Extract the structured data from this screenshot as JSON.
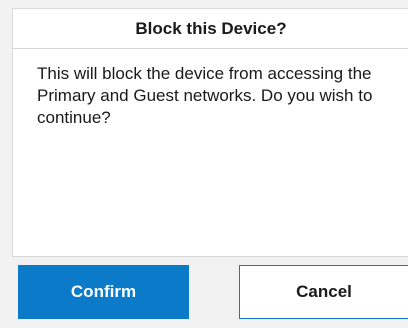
{
  "dialog": {
    "title": "Block this Device?",
    "message": "This will block the device from accessing the Primary and Guest networks. Do you wish to continue?",
    "confirm_label": "Confirm",
    "cancel_label": "Cancel"
  },
  "colors": {
    "accent": "#0a7ac9",
    "background": "#f2f2f2",
    "panel": "#ffffff",
    "text": "#1a1a1a"
  }
}
